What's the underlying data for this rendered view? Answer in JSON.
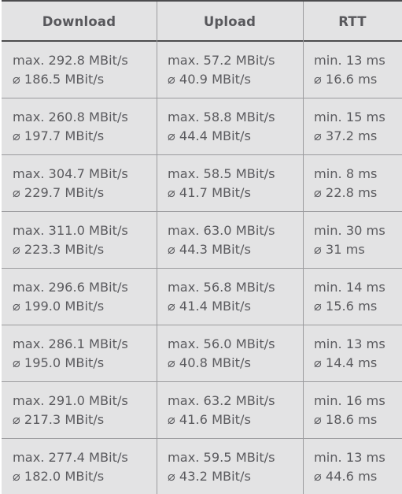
{
  "table": {
    "columns": [
      {
        "key": "download",
        "label": "Download"
      },
      {
        "key": "upload",
        "label": "Upload"
      },
      {
        "key": "rtt",
        "label": "RTT"
      }
    ],
    "symbols": {
      "max_prefix": "max.",
      "min_prefix": "min.",
      "average_glyph": "⌀",
      "unit_throughput": "MBit/s",
      "unit_latency": "ms"
    },
    "colors": {
      "cell_background": "#e3e3e4",
      "header_text": "#58585c",
      "body_text": "#5b5b5f",
      "heavy_rule": "#4c4c4e",
      "light_rule": "#9b9b9e",
      "page_background": "#ffffff"
    },
    "rows": [
      {
        "download": {
          "peak": "max. 292.8 MBit/s",
          "avg": "⌀ 186.5 MBit/s"
        },
        "upload": {
          "peak": "max. 57.2 MBit/s",
          "avg": "⌀ 40.9 MBit/s"
        },
        "rtt": {
          "peak": "min. 13 ms",
          "avg": "⌀ 16.6 ms"
        }
      },
      {
        "download": {
          "peak": "max. 260.8 MBit/s",
          "avg": "⌀ 197.7 MBit/s"
        },
        "upload": {
          "peak": "max. 58.8 MBit/s",
          "avg": "⌀ 44.4 MBit/s"
        },
        "rtt": {
          "peak": "min. 15 ms",
          "avg": "⌀ 37.2 ms"
        }
      },
      {
        "download": {
          "peak": "max. 304.7 MBit/s",
          "avg": "⌀ 229.7 MBit/s"
        },
        "upload": {
          "peak": "max. 58.5 MBit/s",
          "avg": "⌀ 41.7 MBit/s"
        },
        "rtt": {
          "peak": "min. 8 ms",
          "avg": "⌀ 22.8 ms"
        }
      },
      {
        "download": {
          "peak": "max. 311.0 MBit/s",
          "avg": "⌀ 223.3 MBit/s"
        },
        "upload": {
          "peak": "max. 63.0 MBit/s",
          "avg": "⌀ 44.3 MBit/s"
        },
        "rtt": {
          "peak": "min. 30 ms",
          "avg": "⌀ 31 ms"
        }
      },
      {
        "download": {
          "peak": "max. 296.6 MBit/s",
          "avg": "⌀ 199.0 MBit/s"
        },
        "upload": {
          "peak": "max. 56.8 MBit/s",
          "avg": "⌀ 41.4 MBit/s"
        },
        "rtt": {
          "peak": "min. 14 ms",
          "avg": "⌀ 15.6 ms"
        }
      },
      {
        "download": {
          "peak": "max. 286.1 MBit/s",
          "avg": "⌀ 195.0 MBit/s"
        },
        "upload": {
          "peak": "max. 56.0 MBit/s",
          "avg": "⌀ 40.8 MBit/s"
        },
        "rtt": {
          "peak": "min. 13 ms",
          "avg": "⌀ 14.4 ms"
        }
      },
      {
        "download": {
          "peak": "max. 291.0 MBit/s",
          "avg": "⌀ 217.3 MBit/s"
        },
        "upload": {
          "peak": "max. 63.2 MBit/s",
          "avg": "⌀ 41.6 MBit/s"
        },
        "rtt": {
          "peak": "min. 16 ms",
          "avg": "⌀ 18.6 ms"
        }
      },
      {
        "download": {
          "peak": "max. 277.4 MBit/s",
          "avg": "⌀ 182.0 MBit/s"
        },
        "upload": {
          "peak": "max. 59.5 MBit/s",
          "avg": "⌀ 43.2 MBit/s"
        },
        "rtt": {
          "peak": "min. 13 ms",
          "avg": "⌀ 44.6 ms"
        }
      }
    ]
  }
}
